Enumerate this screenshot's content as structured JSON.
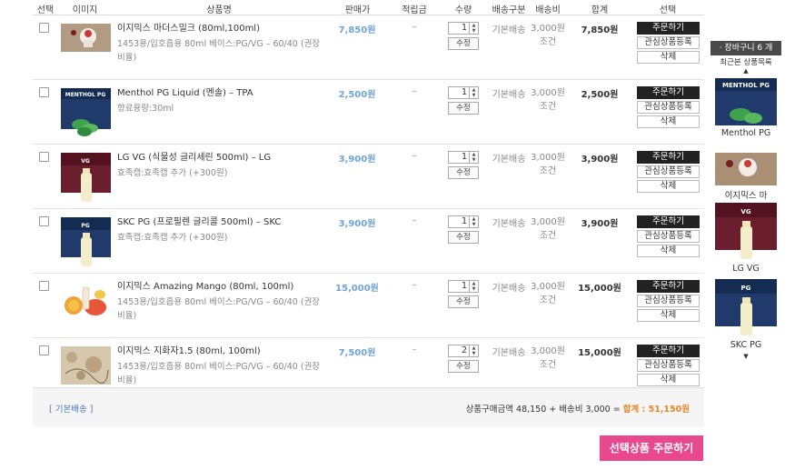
{
  "header": {
    "select": "선택",
    "image": "이미지",
    "product": "상품명",
    "price": "판매가",
    "points": "적립금",
    "qty": "수량",
    "shipping_type": "배송구분",
    "shipping_fee": "배송비",
    "total": "합계",
    "action": "선택"
  },
  "rows": [
    {
      "name": "이지믹스 마더스밀크 (80ml,100ml)",
      "option": "1453용/입호흡용 80ml 베이스:PG/VG – 60/40 (권장비율)",
      "price": "7,850원",
      "points": "–",
      "qty": "1",
      "edit": "수정",
      "ship": "기본배송",
      "fee": "3,000원 조건",
      "total": "7,850원",
      "order": "주문하기",
      "wish": "관심상품등록",
      "del": "삭제"
    },
    {
      "name": "Menthol PG Liquid (멘솔) – TPA",
      "option": "향료용량:30ml",
      "price": "2,500원",
      "points": "–",
      "qty": "1",
      "edit": "수정",
      "ship": "기본배송",
      "fee": "3,000원 조건",
      "total": "2,500원",
      "order": "주문하기",
      "wish": "관심상품등록",
      "del": "삭제"
    },
    {
      "name": "LG VG (식물성 글리세린 500ml) – LG",
      "option": "효족캡:효족캡 추가 (+300원)",
      "price": "3,900원",
      "points": "–",
      "qty": "1",
      "edit": "수정",
      "ship": "기본배송",
      "fee": "3,000원 조건",
      "total": "3,900원",
      "order": "주문하기",
      "wish": "관심상품등록",
      "del": "삭제"
    },
    {
      "name": "SKC PG (프로필렌 글리콜 500ml) – SKC",
      "option": "효족캡:효족캡 추가 (+300원)",
      "price": "3,900원",
      "points": "–",
      "qty": "1",
      "edit": "수정",
      "ship": "기본배송",
      "fee": "3,000원 조건",
      "total": "3,900원",
      "order": "주문하기",
      "wish": "관심상품등록",
      "del": "삭제"
    },
    {
      "name": "이지믹스 Amazing Mango (80ml, 100ml)",
      "option": "1453용/입호흡용 80ml 베이스:PG/VG – 60/40 (권장비율)",
      "price": "15,000원",
      "points": "–",
      "qty": "1",
      "edit": "수정",
      "ship": "기본배송",
      "fee": "3,000원 조건",
      "total": "15,000원",
      "order": "주문하기",
      "wish": "관심상품등록",
      "del": "삭제"
    },
    {
      "name": "이지믹스 지화자1.5 (80ml, 100ml)",
      "option": "1453용/입호흡용 80ml 베이스:PG/VG – 60/40 (권장비율)",
      "price": "7,500원",
      "points": "–",
      "qty": "2",
      "edit": "수정",
      "ship": "기본배송",
      "fee": "3,000원 조건",
      "total": "15,000원",
      "order": "주문하기",
      "wish": "관심상품등록",
      "del": "삭제"
    }
  ],
  "footer": {
    "ship_label": "[ 기본배송 ]",
    "summary_prefix": "상품구매금액 48,150 + 배송비 3,000 = ",
    "summary_total": "합계 : 51,150원"
  },
  "order_selected": "선택상품 주문하기",
  "side": {
    "cart_label": "· 장바구니   6 개",
    "recent_label": "최근본 상품목록",
    "items": [
      "Menthol PG",
      "이지믹스 마",
      "LG VG",
      "SKC PG"
    ]
  },
  "colors": {
    "accent_pink": "#e8488d",
    "price_blue": "#6ea5d6",
    "total_orange": "#e8862b"
  }
}
